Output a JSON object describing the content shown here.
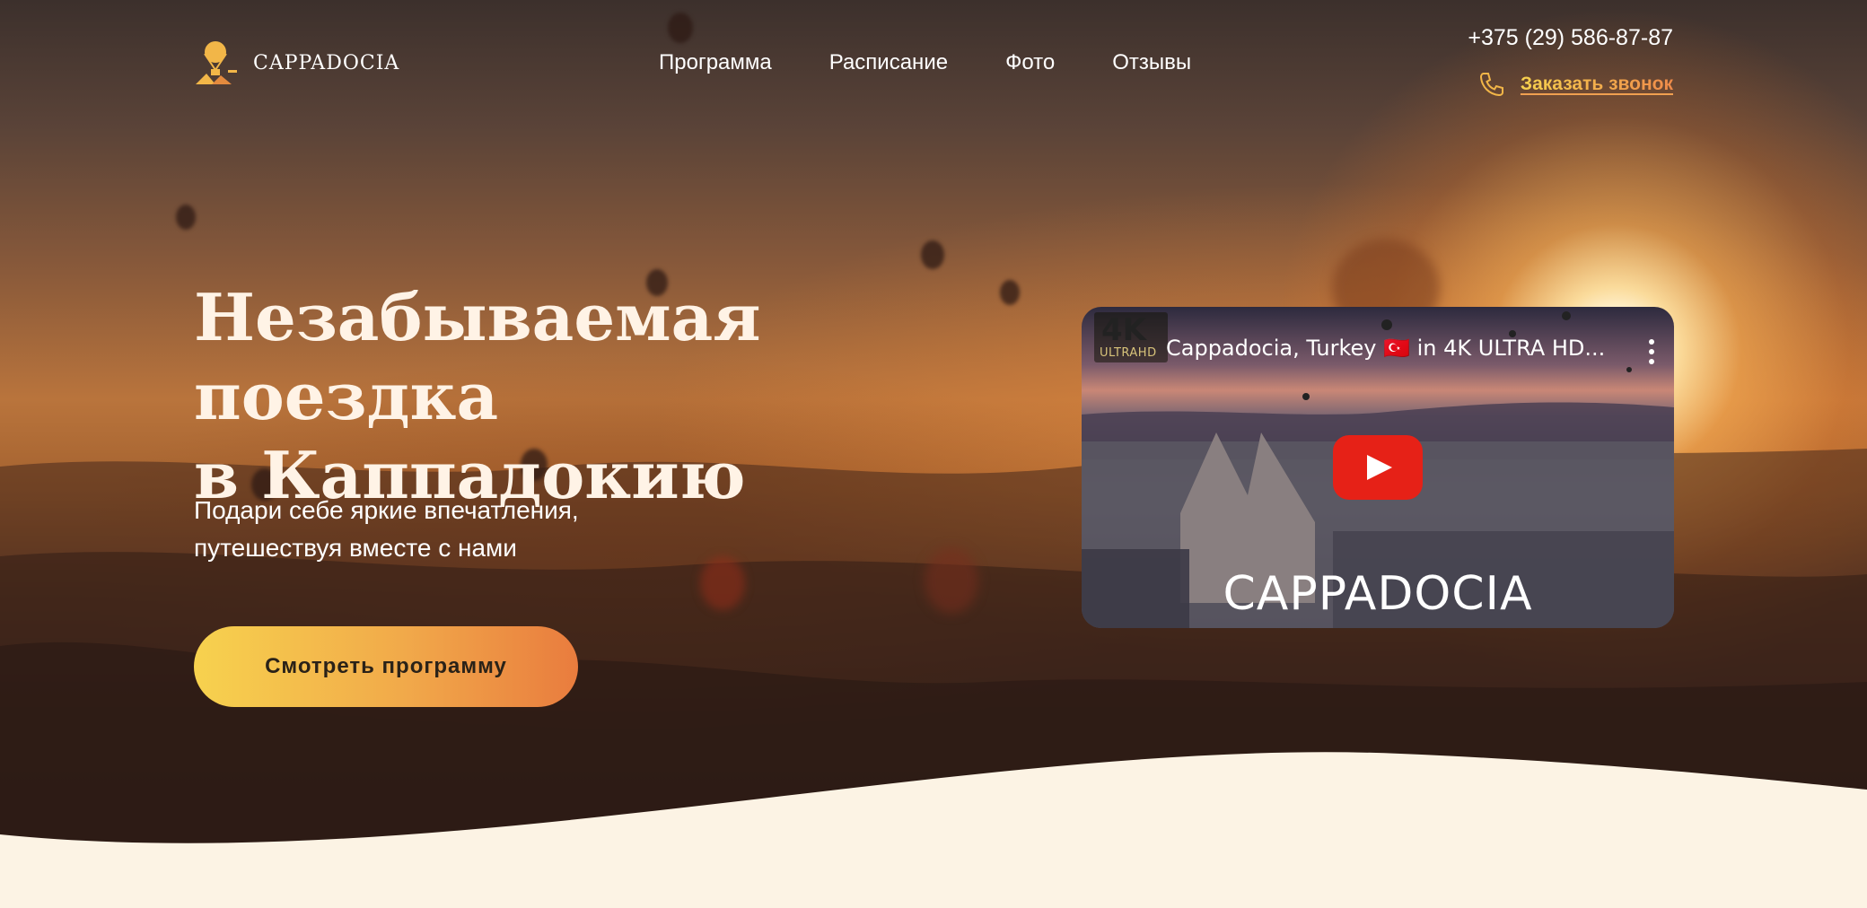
{
  "brand": {
    "name": "CAPPADOCIA"
  },
  "nav": [
    "Программа",
    "Расписание",
    "Фото",
    "Отзывы"
  ],
  "contact": {
    "phone": "+375 (29) 586-87-87",
    "callback_label": "Заказать звонок"
  },
  "hero": {
    "title_line1": "Незабываемая поездка",
    "title_line2": "в Каппадокию",
    "subtitle_line1": "Подари себе яркие впечатления,",
    "subtitle_line2": "путешествуя вместе с нами",
    "cta_label": "Смотреть программу"
  },
  "video": {
    "title": "Cappadocia, Turkey 🇹🇷 in 4K ULTRA HD...",
    "badge_top": "4K",
    "badge_bottom": "ULTRAHD",
    "caption": "CAPPADOCIA"
  },
  "colors": {
    "accent_start": "#f7d24e",
    "accent_end": "#e97c3e",
    "cream": "#fcf3e4",
    "play_red": "#e62117"
  },
  "icons": [
    "logo-icon",
    "phone-icon",
    "play-icon",
    "more-vert-icon"
  ]
}
